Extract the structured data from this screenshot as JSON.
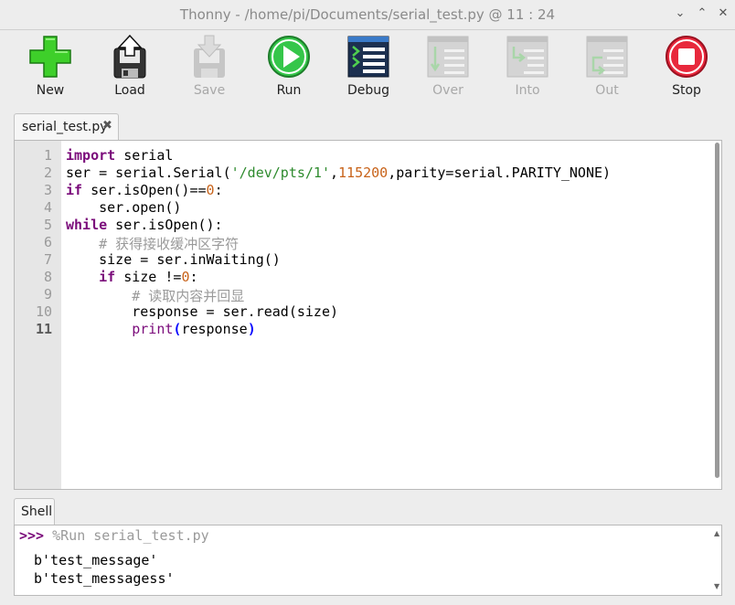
{
  "window": {
    "title": "Thonny  -  /home/pi/Documents/serial_test.py  @  11 : 24",
    "minimize": "⌄",
    "maximize": "⌃",
    "close": "✕"
  },
  "toolbar": {
    "new": "New",
    "load": "Load",
    "save": "Save",
    "run": "Run",
    "debug": "Debug",
    "over": "Over",
    "into": "Into",
    "out": "Out",
    "stop": "Stop"
  },
  "editor": {
    "tab_label": "serial_test.py",
    "tab_close": "✖",
    "line_numbers": [
      "1",
      "2",
      "3",
      "4",
      "5",
      "6",
      "7",
      "8",
      "9",
      "10",
      "11"
    ],
    "current_line": "11",
    "code": {
      "l1": {
        "kw": "import",
        "rest": " serial"
      },
      "l2": {
        "a": "ser = serial.Serial(",
        "str": "'/dev/pts/1'",
        "b": ",",
        "num": "115200",
        "c": ",parity=serial.PARITY_NONE)"
      },
      "l3": {
        "kw": "if",
        "a": " ser.isOpen()==",
        "num": "0",
        "b": ":"
      },
      "l4": {
        "a": "    ser.open()"
      },
      "l5": {
        "kw": "while",
        "a": " ser.isOpen():"
      },
      "l6": {
        "cmt": "    # 获得接收缓冲区字符"
      },
      "l7": {
        "a": "    size = ser.inWaiting()"
      },
      "l8": {
        "indent": "    ",
        "kw": "if",
        "a": " size !=",
        "num": "0",
        "b": ":"
      },
      "l9": {
        "cmt": "        # 读取内容并回显"
      },
      "l10": {
        "a": "        response = ser.read(size)"
      },
      "l11": {
        "indent": "        ",
        "fn": "print",
        "p1": "(",
        "a": "response",
        "p2": ")"
      }
    }
  },
  "shell": {
    "tab_label": "Shell",
    "prompt": ">>>",
    "run_command": " %Run serial_test.py",
    "output": [
      "b'test_message'",
      "b'test_messagess'"
    ],
    "scroll_up": "▲",
    "scroll_down": "▼"
  }
}
